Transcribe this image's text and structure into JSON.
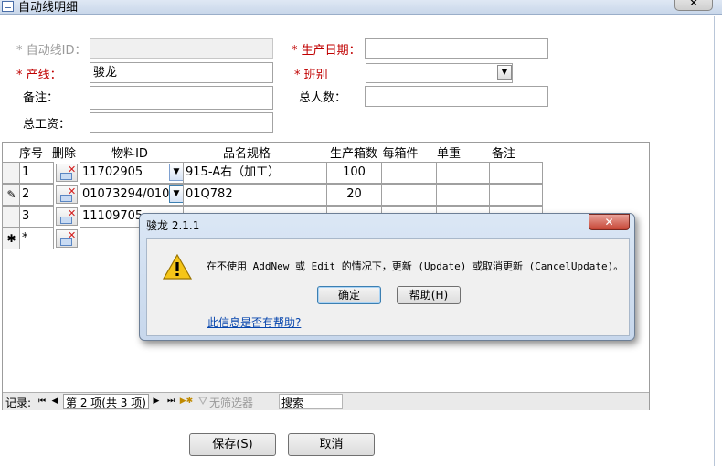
{
  "window": {
    "title": "自动线明细",
    "close_glyph": "✕"
  },
  "form": {
    "auto_line_id": {
      "label": "* 自动线ID：",
      "value": ""
    },
    "production_date": {
      "label": "* 生产日期：",
      "value": ""
    },
    "production_line": {
      "label": "* 产线：",
      "value": "骏龙"
    },
    "shift": {
      "label": "* 班别",
      "value": ""
    },
    "remarks": {
      "label": "备注：",
      "value": ""
    },
    "total_people": {
      "label": "总人数：",
      "value": ""
    },
    "total_wage": {
      "label": "总工资：",
      "value": ""
    }
  },
  "grid": {
    "headers": [
      "序号",
      "删除",
      "物料ID",
      "品名规格",
      "生产箱数",
      "每箱件",
      "单重",
      "备注"
    ],
    "rows": [
      {
        "seq": "1",
        "material_id": "11702905",
        "spec": "915-A右（加工）",
        "boxes": "100"
      },
      {
        "seq": "2",
        "material_id": "01073294/010",
        "spec": "01Q782",
        "boxes": "20"
      },
      {
        "seq": "3",
        "material_id": "11109705",
        "spec": "",
        "boxes": ""
      },
      {
        "seq": "*",
        "material_id": "",
        "spec": "",
        "boxes": ""
      }
    ],
    "row_selectors": [
      "",
      "✎",
      "",
      "✱"
    ]
  },
  "navbar": {
    "record_label": "记录:",
    "position": "第 2 项(共 3 项)",
    "filter": "无筛选器",
    "search": "搜索",
    "first": "⏮",
    "prev": "◀",
    "next": "▶",
    "last": "⏭",
    "new": "▶✱"
  },
  "buttons": {
    "save": "保存(S)",
    "cancel": "取消"
  },
  "dialog": {
    "title": "骏龙 2.1.1",
    "message": "在不使用 AddNew 或 Edit 的情况下，更新 (Update) 或取消更新 (CancelUpdate)。",
    "ok": "确定",
    "help": "帮助(H)",
    "help_link": "此信息是否有帮助?",
    "icon": "warning-icon"
  }
}
